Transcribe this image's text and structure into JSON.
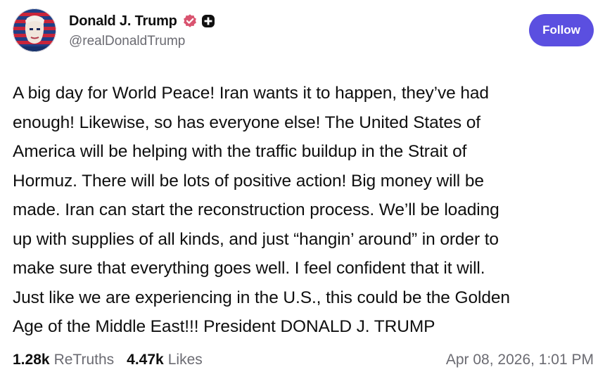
{
  "author": {
    "display_name": "Donald J. Trump",
    "handle": "@realDonaldTrump",
    "avatar_icon": "profile-avatar",
    "verified_icon": "verified-badge-icon",
    "plus_icon": "plus-badge-icon"
  },
  "actions": {
    "follow_label": "Follow"
  },
  "post": {
    "lines": [
      "A big day for World Peace! Iran wants it to happen, they’ve had",
      "enough! Likewise, so has everyone else! The United States of",
      "America will be helping with the traffic buildup in the Strait of",
      "Hormuz. There will be lots of positive action! Big money will be",
      "made. Iran can start the reconstruction process. We’ll be loading",
      "up with supplies of all kinds, and just “hangin’ around” in order to",
      "make sure that everything goes well. I feel confident that it will.",
      "Just like we are experiencing in the U.S., this could be the Golden",
      "Age of the Middle East!!! President DONALD J. TRUMP"
    ]
  },
  "stats": {
    "retruths_count": "1.28k",
    "retruths_label": "ReTruths",
    "likes_count": "4.47k",
    "likes_label": "Likes",
    "timestamp": "Apr 08, 2026, 1:01 PM"
  },
  "colors": {
    "accent": "#5b4fe0",
    "verified": "#d9536f",
    "muted_text": "#6b6b72",
    "text": "#0f0f0f"
  }
}
